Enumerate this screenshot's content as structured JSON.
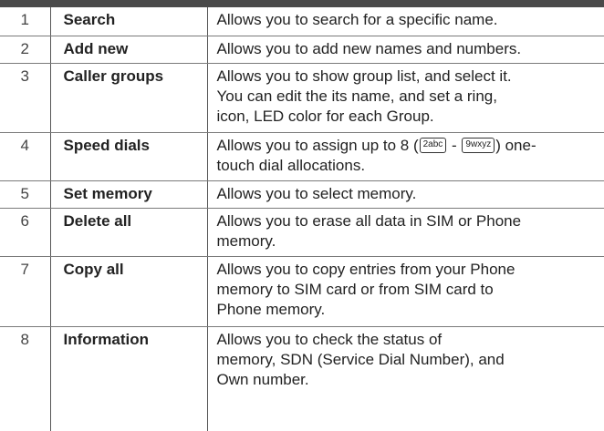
{
  "table": {
    "rows": [
      {
        "num": "1",
        "name": "Search",
        "desc_lines": [
          "Allows you to search for a specific name."
        ]
      },
      {
        "num": "2",
        "name": "Add new",
        "desc_lines": [
          "Allows you to add new names and numbers."
        ]
      },
      {
        "num": "3",
        "name": "Caller groups",
        "desc_lines": [
          "Allows you to show group list, and select it.",
          "You can edit the its name, and set a ring,",
          "icon, LED color for each Group."
        ]
      },
      {
        "num": "4",
        "name": "Speed dials",
        "desc_line1_before": "Allows you to assign up to 8 (",
        "key_from": "2abc",
        "key_sep": " - ",
        "key_to": "9wxyz",
        "desc_line1_after": ") one-",
        "desc_line2": "touch dial allocations."
      },
      {
        "num": "5",
        "name": "Set memory",
        "desc_lines": [
          "Allows you to select memory."
        ]
      },
      {
        "num": "6",
        "name": "Delete all",
        "desc_lines": [
          "Allows you to erase all data in SIM or Phone",
          "memory."
        ]
      },
      {
        "num": "7",
        "name": "Copy all",
        "desc_lines": [
          "Allows you to copy entries from your Phone",
          "memory to SIM card or from SIM card to",
          "Phone memory."
        ]
      },
      {
        "num": "8",
        "name": "Information",
        "desc_lines": [
          "Allows you to check the status of",
          "memory, SDN (Service Dial Number), and",
          "Own number."
        ]
      }
    ]
  },
  "colors": {
    "header_bar": "#4a4a4a",
    "rule": "#7a7a7a",
    "text": "#222222"
  }
}
